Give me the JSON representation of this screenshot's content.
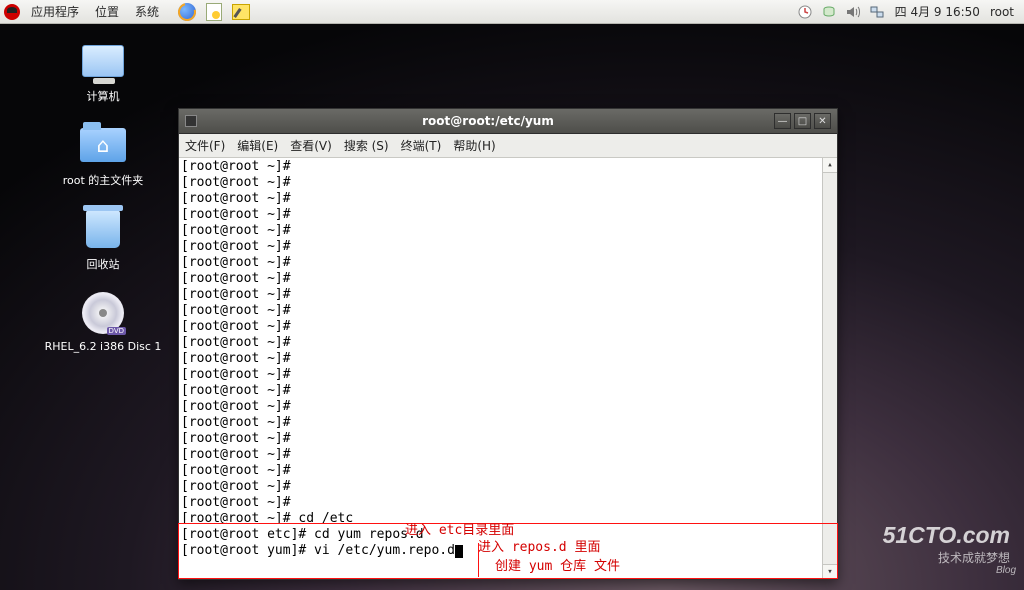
{
  "topbar": {
    "menus": [
      "应用程序",
      "位置",
      "系统"
    ],
    "clock": "四 4月  9 16:50",
    "user": "root"
  },
  "desktop": {
    "computer": "计算机",
    "home": "root 的主文件夹",
    "trash": "回收站",
    "disc": "RHEL_6.2 i386 Disc 1"
  },
  "terminal": {
    "title": "root@root:/etc/yum",
    "menus": {
      "file": "文件(F)",
      "edit": "编辑(E)",
      "view": "查看(V)",
      "search": "搜索 (S)",
      "terminal": "终端(T)",
      "help": "帮助(H)"
    },
    "prompt_lines": [
      "[root@root ~]#",
      "[root@root ~]#",
      "[root@root ~]#",
      "[root@root ~]#",
      "[root@root ~]#",
      "[root@root ~]#",
      "[root@root ~]#",
      "[root@root ~]#",
      "[root@root ~]#",
      "[root@root ~]#",
      "[root@root ~]#",
      "[root@root ~]#",
      "[root@root ~]#",
      "[root@root ~]#",
      "[root@root ~]#",
      "[root@root ~]#",
      "[root@root ~]#",
      "[root@root ~]#",
      "[root@root ~]#",
      "[root@root ~]#",
      "[root@root ~]#",
      "[root@root ~]#"
    ],
    "cmd1_prompt": "[root@root ~]# ",
    "cmd1": "cd /etc",
    "cmd2_prompt": "[root@root etc]# ",
    "cmd2": "cd yum repos.d",
    "cmd3_prompt": "[root@root yum]# ",
    "cmd3": "vi /etc/yum.repo.d"
  },
  "annotations": {
    "a1": "进入 etc目录里面",
    "a2": "进入 repos.d 里面",
    "a3": "创建 yum 仓库 文件"
  },
  "watermark": {
    "big": "51CTO.com",
    "sm": "技术成就梦想",
    "tiny": "Blog"
  }
}
